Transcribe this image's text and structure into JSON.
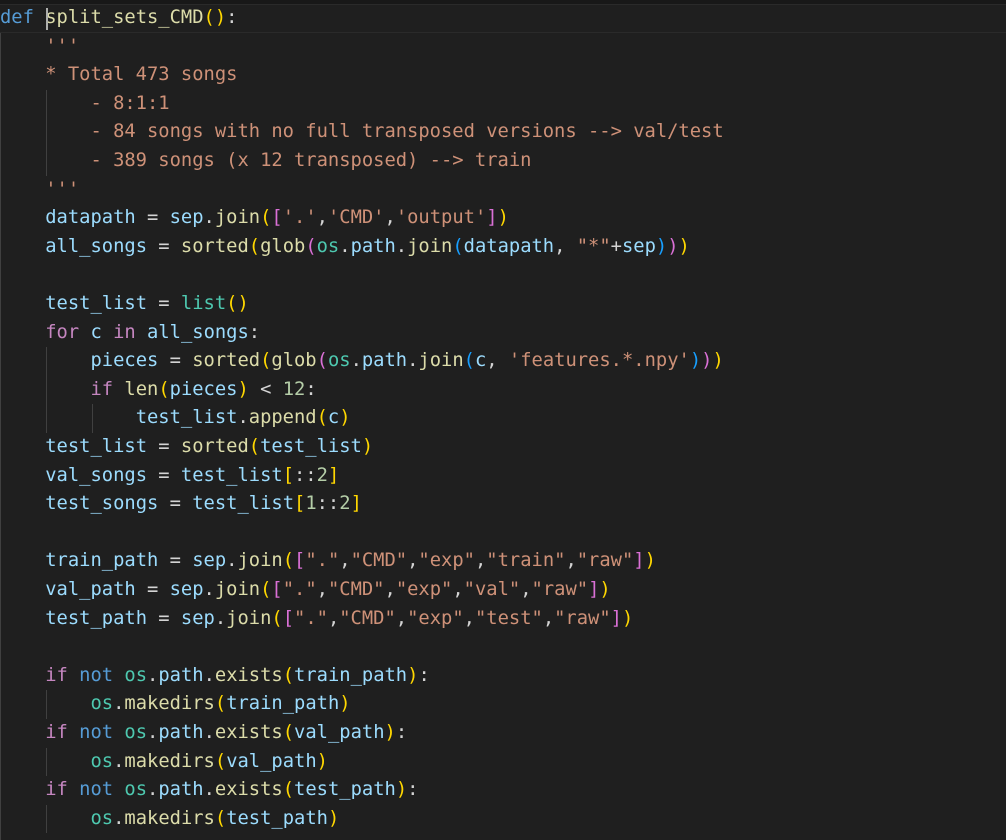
{
  "colors": {
    "background": "#1f1f1f",
    "keyword": "#569cd6",
    "control": "#c586c0",
    "function": "#dcdcaa",
    "variable": "#9cdcfe",
    "module": "#4ec9b0",
    "string": "#ce9178",
    "number": "#b5cea8",
    "bracket_1": "#ffd700",
    "bracket_2": "#da70d6",
    "bracket_3": "#179fff"
  },
  "lines": [
    [
      [
        "def",
        "t-kw"
      ],
      [
        " ",
        "t-op"
      ],
      [
        "split_sets_CMD",
        "t-fn"
      ],
      [
        "()",
        "b1"
      ],
      [
        ":",
        "t-op"
      ]
    ],
    [
      [
        "    '''",
        "t-str"
      ]
    ],
    [
      [
        "    * Total 473 songs",
        "t-str"
      ]
    ],
    [
      [
        "        - 8:1:1",
        "t-str"
      ]
    ],
    [
      [
        "        - 84 songs with no full transposed versions --> val/test",
        "t-str"
      ]
    ],
    [
      [
        "        - 389 songs (x 12 transposed) --> train",
        "t-str"
      ]
    ],
    [
      [
        "    '''",
        "t-str"
      ]
    ],
    [
      [
        "    ",
        "t-op"
      ],
      [
        "datapath",
        "t-var"
      ],
      [
        " = ",
        "t-op"
      ],
      [
        "sep",
        "t-var"
      ],
      [
        ".",
        "t-op"
      ],
      [
        "join",
        "t-fn"
      ],
      [
        "(",
        "b1"
      ],
      [
        "[",
        "b2"
      ],
      [
        "'.'",
        "t-str"
      ],
      [
        ",",
        "t-op"
      ],
      [
        "'CMD'",
        "t-str"
      ],
      [
        ",",
        "t-op"
      ],
      [
        "'output'",
        "t-str"
      ],
      [
        "]",
        "b2"
      ],
      [
        ")",
        "b1"
      ]
    ],
    [
      [
        "    ",
        "t-op"
      ],
      [
        "all_songs",
        "t-var"
      ],
      [
        " = ",
        "t-op"
      ],
      [
        "sorted",
        "t-fn"
      ],
      [
        "(",
        "b1"
      ],
      [
        "glob",
        "t-fn"
      ],
      [
        "(",
        "b2"
      ],
      [
        "os",
        "t-mod"
      ],
      [
        ".",
        "t-op"
      ],
      [
        "path",
        "t-var"
      ],
      [
        ".",
        "t-op"
      ],
      [
        "join",
        "t-fn"
      ],
      [
        "(",
        "b3"
      ],
      [
        "datapath",
        "t-var"
      ],
      [
        ", ",
        "t-op"
      ],
      [
        "\"*\"",
        "t-str"
      ],
      [
        "+",
        "t-op"
      ],
      [
        "sep",
        "t-var"
      ],
      [
        ")",
        "b3"
      ],
      [
        ")",
        "b2"
      ],
      [
        ")",
        "b1"
      ]
    ],
    [],
    [
      [
        "    ",
        "t-op"
      ],
      [
        "test_list",
        "t-var"
      ],
      [
        " = ",
        "t-op"
      ],
      [
        "list",
        "t-mod"
      ],
      [
        "()",
        "b1"
      ]
    ],
    [
      [
        "    ",
        "t-op"
      ],
      [
        "for",
        "t-ctl"
      ],
      [
        " ",
        "t-op"
      ],
      [
        "c",
        "t-var"
      ],
      [
        " ",
        "t-op"
      ],
      [
        "in",
        "t-ctl"
      ],
      [
        " ",
        "t-op"
      ],
      [
        "all_songs",
        "t-var"
      ],
      [
        ":",
        "t-op"
      ]
    ],
    [
      [
        "        ",
        "t-op"
      ],
      [
        "pieces",
        "t-var"
      ],
      [
        " = ",
        "t-op"
      ],
      [
        "sorted",
        "t-fn"
      ],
      [
        "(",
        "b1"
      ],
      [
        "glob",
        "t-fn"
      ],
      [
        "(",
        "b2"
      ],
      [
        "os",
        "t-mod"
      ],
      [
        ".",
        "t-op"
      ],
      [
        "path",
        "t-var"
      ],
      [
        ".",
        "t-op"
      ],
      [
        "join",
        "t-fn"
      ],
      [
        "(",
        "b3"
      ],
      [
        "c",
        "t-var"
      ],
      [
        ", ",
        "t-op"
      ],
      [
        "'features.*.npy'",
        "t-str"
      ],
      [
        ")",
        "b3"
      ],
      [
        ")",
        "b2"
      ],
      [
        ")",
        "b1"
      ]
    ],
    [
      [
        "        ",
        "t-op"
      ],
      [
        "if",
        "t-ctl"
      ],
      [
        " ",
        "t-op"
      ],
      [
        "len",
        "t-fn"
      ],
      [
        "(",
        "b1"
      ],
      [
        "pieces",
        "t-var"
      ],
      [
        ")",
        "b1"
      ],
      [
        " < ",
        "t-op"
      ],
      [
        "12",
        "t-num"
      ],
      [
        ":",
        "t-op"
      ]
    ],
    [
      [
        "            ",
        "t-op"
      ],
      [
        "test_list",
        "t-var"
      ],
      [
        ".",
        "t-op"
      ],
      [
        "append",
        "t-fn"
      ],
      [
        "(",
        "b1"
      ],
      [
        "c",
        "t-var"
      ],
      [
        ")",
        "b1"
      ]
    ],
    [
      [
        "    ",
        "t-op"
      ],
      [
        "test_list",
        "t-var"
      ],
      [
        " = ",
        "t-op"
      ],
      [
        "sorted",
        "t-fn"
      ],
      [
        "(",
        "b1"
      ],
      [
        "test_list",
        "t-var"
      ],
      [
        ")",
        "b1"
      ]
    ],
    [
      [
        "    ",
        "t-op"
      ],
      [
        "val_songs",
        "t-var"
      ],
      [
        " = ",
        "t-op"
      ],
      [
        "test_list",
        "t-var"
      ],
      [
        "[",
        "b1"
      ],
      [
        "::",
        "t-op"
      ],
      [
        "2",
        "t-num"
      ],
      [
        "]",
        "b1"
      ]
    ],
    [
      [
        "    ",
        "t-op"
      ],
      [
        "test_songs",
        "t-var"
      ],
      [
        " = ",
        "t-op"
      ],
      [
        "test_list",
        "t-var"
      ],
      [
        "[",
        "b1"
      ],
      [
        "1",
        "t-num"
      ],
      [
        "::",
        "t-op"
      ],
      [
        "2",
        "t-num"
      ],
      [
        "]",
        "b1"
      ]
    ],
    [],
    [
      [
        "    ",
        "t-op"
      ],
      [
        "train_path",
        "t-var"
      ],
      [
        " = ",
        "t-op"
      ],
      [
        "sep",
        "t-var"
      ],
      [
        ".",
        "t-op"
      ],
      [
        "join",
        "t-fn"
      ],
      [
        "(",
        "b1"
      ],
      [
        "[",
        "b2"
      ],
      [
        "\".\"",
        "t-str"
      ],
      [
        ",",
        "t-op"
      ],
      [
        "\"CMD\"",
        "t-str"
      ],
      [
        ",",
        "t-op"
      ],
      [
        "\"exp\"",
        "t-str"
      ],
      [
        ",",
        "t-op"
      ],
      [
        "\"train\"",
        "t-str"
      ],
      [
        ",",
        "t-op"
      ],
      [
        "\"raw\"",
        "t-str"
      ],
      [
        "]",
        "b2"
      ],
      [
        ")",
        "b1"
      ]
    ],
    [
      [
        "    ",
        "t-op"
      ],
      [
        "val_path",
        "t-var"
      ],
      [
        " = ",
        "t-op"
      ],
      [
        "sep",
        "t-var"
      ],
      [
        ".",
        "t-op"
      ],
      [
        "join",
        "t-fn"
      ],
      [
        "(",
        "b1"
      ],
      [
        "[",
        "b2"
      ],
      [
        "\".\"",
        "t-str"
      ],
      [
        ",",
        "t-op"
      ],
      [
        "\"CMD\"",
        "t-str"
      ],
      [
        ",",
        "t-op"
      ],
      [
        "\"exp\"",
        "t-str"
      ],
      [
        ",",
        "t-op"
      ],
      [
        "\"val\"",
        "t-str"
      ],
      [
        ",",
        "t-op"
      ],
      [
        "\"raw\"",
        "t-str"
      ],
      [
        "]",
        "b2"
      ],
      [
        ")",
        "b1"
      ]
    ],
    [
      [
        "    ",
        "t-op"
      ],
      [
        "test_path",
        "t-var"
      ],
      [
        " = ",
        "t-op"
      ],
      [
        "sep",
        "t-var"
      ],
      [
        ".",
        "t-op"
      ],
      [
        "join",
        "t-fn"
      ],
      [
        "(",
        "b1"
      ],
      [
        "[",
        "b2"
      ],
      [
        "\".\"",
        "t-str"
      ],
      [
        ",",
        "t-op"
      ],
      [
        "\"CMD\"",
        "t-str"
      ],
      [
        ",",
        "t-op"
      ],
      [
        "\"exp\"",
        "t-str"
      ],
      [
        ",",
        "t-op"
      ],
      [
        "\"test\"",
        "t-str"
      ],
      [
        ",",
        "t-op"
      ],
      [
        "\"raw\"",
        "t-str"
      ],
      [
        "]",
        "b2"
      ],
      [
        ")",
        "b1"
      ]
    ],
    [],
    [
      [
        "    ",
        "t-op"
      ],
      [
        "if",
        "t-ctl"
      ],
      [
        " ",
        "t-op"
      ],
      [
        "not",
        "t-kw"
      ],
      [
        " ",
        "t-op"
      ],
      [
        "os",
        "t-mod"
      ],
      [
        ".",
        "t-op"
      ],
      [
        "path",
        "t-var"
      ],
      [
        ".",
        "t-op"
      ],
      [
        "exists",
        "t-fn"
      ],
      [
        "(",
        "b1"
      ],
      [
        "train_path",
        "t-var"
      ],
      [
        ")",
        "b1"
      ],
      [
        ":",
        "t-op"
      ]
    ],
    [
      [
        "        ",
        "t-op"
      ],
      [
        "os",
        "t-mod"
      ],
      [
        ".",
        "t-op"
      ],
      [
        "makedirs",
        "t-fn"
      ],
      [
        "(",
        "b1"
      ],
      [
        "train_path",
        "t-var"
      ],
      [
        ")",
        "b1"
      ]
    ],
    [
      [
        "    ",
        "t-op"
      ],
      [
        "if",
        "t-ctl"
      ],
      [
        " ",
        "t-op"
      ],
      [
        "not",
        "t-kw"
      ],
      [
        " ",
        "t-op"
      ],
      [
        "os",
        "t-mod"
      ],
      [
        ".",
        "t-op"
      ],
      [
        "path",
        "t-var"
      ],
      [
        ".",
        "t-op"
      ],
      [
        "exists",
        "t-fn"
      ],
      [
        "(",
        "b1"
      ],
      [
        "val_path",
        "t-var"
      ],
      [
        ")",
        "b1"
      ],
      [
        ":",
        "t-op"
      ]
    ],
    [
      [
        "        ",
        "t-op"
      ],
      [
        "os",
        "t-mod"
      ],
      [
        ".",
        "t-op"
      ],
      [
        "makedirs",
        "t-fn"
      ],
      [
        "(",
        "b1"
      ],
      [
        "val_path",
        "t-var"
      ],
      [
        ")",
        "b1"
      ]
    ],
    [
      [
        "    ",
        "t-op"
      ],
      [
        "if",
        "t-ctl"
      ],
      [
        " ",
        "t-op"
      ],
      [
        "not",
        "t-kw"
      ],
      [
        " ",
        "t-op"
      ],
      [
        "os",
        "t-mod"
      ],
      [
        ".",
        "t-op"
      ],
      [
        "path",
        "t-var"
      ],
      [
        ".",
        "t-op"
      ],
      [
        "exists",
        "t-fn"
      ],
      [
        "(",
        "b1"
      ],
      [
        "test_path",
        "t-var"
      ],
      [
        ")",
        "b1"
      ],
      [
        ":",
        "t-op"
      ]
    ],
    [
      [
        "        ",
        "t-op"
      ],
      [
        "os",
        "t-mod"
      ],
      [
        ".",
        "t-op"
      ],
      [
        "makedirs",
        "t-fn"
      ],
      [
        "(",
        "b1"
      ],
      [
        "test_path",
        "t-var"
      ],
      [
        ")",
        "b1"
      ]
    ]
  ]
}
